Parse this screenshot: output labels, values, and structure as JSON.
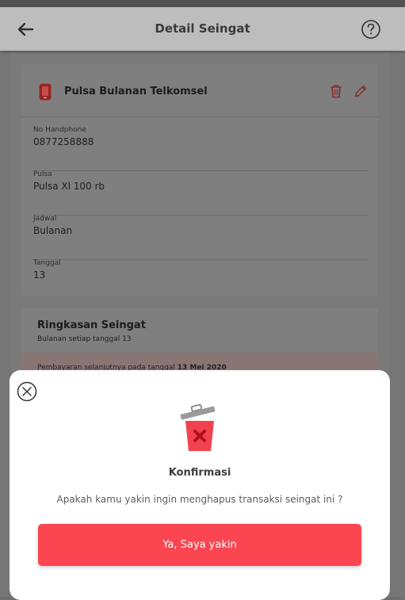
{
  "header": {
    "title": "Detail Seingat",
    "back_icon": "arrow-left-icon",
    "help_icon": "question-circle-icon"
  },
  "item": {
    "title": "Pulsa Bulanan Telkomsel",
    "icon": "phone-icon",
    "delete_icon": "trash-icon",
    "edit_icon": "pencil-icon"
  },
  "fields": [
    {
      "label": "No Handphone",
      "value": "0877258888"
    },
    {
      "label": "Pulsa",
      "value": "Pulsa Xl 100 rb"
    },
    {
      "label": "Jadwal",
      "value": "Bulanan"
    },
    {
      "label": "Tanggal",
      "value": "13"
    }
  ],
  "summary": {
    "title": "Ringkasan Seingat",
    "subtitle": "Bulanan setiap tanggal 13",
    "note_prefix": "Pembayaran selanjutnya pada tanggal",
    "note_date": "13 Mei 2020"
  },
  "modal": {
    "close_icon": "close-circle-icon",
    "illustration": "trash-bin-illustration",
    "title": "Konfirmasi",
    "message": "Apakah kamu yakin ingin menghapus transaksi seingat ini ?",
    "confirm_label": "Ya, Saya yakin"
  },
  "colors": {
    "accent": "#fb4550",
    "icon_red": "#e53935"
  }
}
